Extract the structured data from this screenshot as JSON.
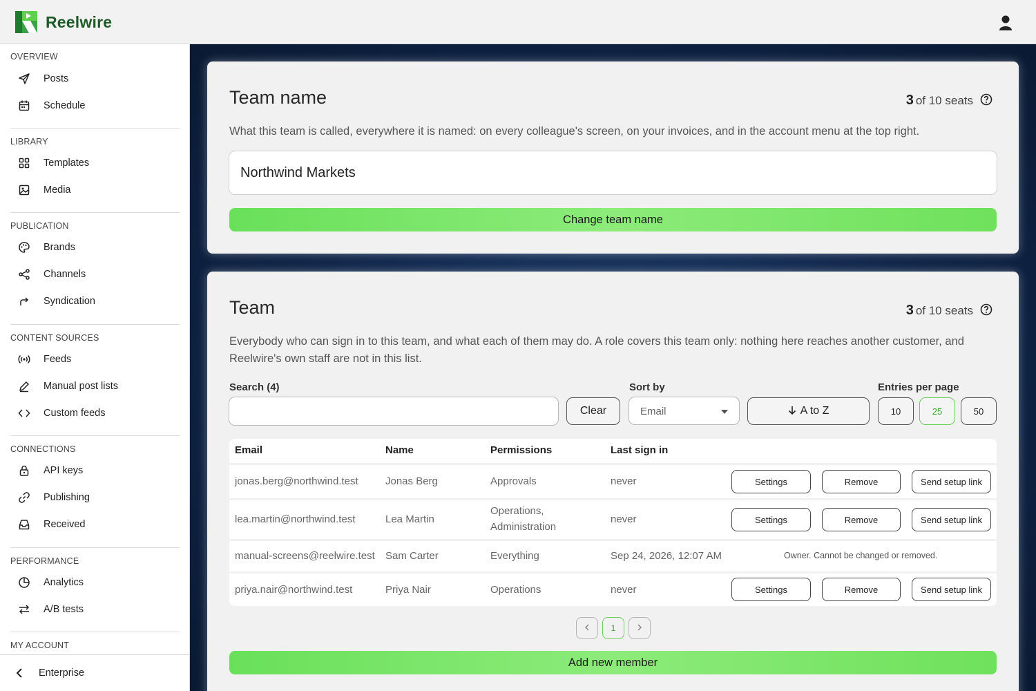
{
  "app": {
    "brand": "Reelwire"
  },
  "sidebar": {
    "sections": [
      {
        "heading": "OVERVIEW",
        "items": [
          {
            "label": "Posts",
            "icon": "send-icon"
          },
          {
            "label": "Schedule",
            "icon": "calendar-icon"
          }
        ]
      },
      {
        "heading": "LIBRARY",
        "items": [
          {
            "label": "Templates",
            "icon": "grid-icon"
          },
          {
            "label": "Media",
            "icon": "image-icon"
          }
        ]
      },
      {
        "heading": "PUBLICATION",
        "items": [
          {
            "label": "Brands",
            "icon": "palette-icon"
          },
          {
            "label": "Channels",
            "icon": "share-icon"
          },
          {
            "label": "Syndication",
            "icon": "forward-arrow-icon"
          }
        ]
      },
      {
        "heading": "CONTENT SOURCES",
        "items": [
          {
            "label": "Feeds",
            "icon": "broadcast-icon"
          },
          {
            "label": "Manual post lists",
            "icon": "pencil-icon"
          },
          {
            "label": "Custom feeds",
            "icon": "code-icon"
          }
        ]
      },
      {
        "heading": "CONNECTIONS",
        "items": [
          {
            "label": "API keys",
            "icon": "lock-icon"
          },
          {
            "label": "Publishing",
            "icon": "link-icon"
          },
          {
            "label": "Received",
            "icon": "inbox-icon"
          }
        ]
      },
      {
        "heading": "PERFORMANCE",
        "items": [
          {
            "label": "Analytics",
            "icon": "pie-chart-icon"
          },
          {
            "label": "A/B tests",
            "icon": "swap-icon"
          }
        ]
      },
      {
        "heading": "MY ACCOUNT",
        "items": []
      }
    ],
    "footer": {
      "label": "Enterprise"
    }
  },
  "team_name_card": {
    "title": "Team name",
    "seats_used": "3",
    "seats_text": "of 10 seats",
    "description": "What this team is called, everywhere it is named: on every colleague's screen, on your invoices, and in the account menu at the top right.",
    "name_value": "Northwind Markets",
    "submit_label": "Change team name"
  },
  "team_card": {
    "title": "Team",
    "seats_used": "3",
    "seats_text": "of 10 seats",
    "description": "Everybody who can sign in to this team, and what each of them may do. A role covers this team only: nothing here reaches another customer, and Reelwire's own staff are not in this list.",
    "search_label": "Search (4)",
    "search_value": "",
    "clear_label": "Clear",
    "sort_label": "Sort by",
    "sort_value": "Email",
    "order_label": "A to Z",
    "entries_label": "Entries per page",
    "entries_options": [
      "10",
      "25",
      "50"
    ],
    "entries_selected": "25",
    "columns": [
      "Email",
      "Name",
      "Permissions",
      "Last sign in"
    ],
    "rows": [
      {
        "email": "jonas.berg@northwind.test",
        "name": "Jonas Berg",
        "permissions": "Approvals",
        "last_sign_in": "never"
      },
      {
        "email": "lea.martin@northwind.test",
        "name": "Lea Martin",
        "permissions": "Operations,\nAdministration",
        "last_sign_in": "never"
      },
      {
        "email": "manual-screens@reelwire.test",
        "name": "Sam Carter",
        "permissions": "Everything",
        "last_sign_in": "Sep 24, 2026, 12:07 AM",
        "note": "Owner. Cannot be changed or removed."
      },
      {
        "email": "priya.nair@northwind.test",
        "name": "Priya Nair",
        "permissions": "Operations",
        "last_sign_in": "never"
      }
    ],
    "row_actions": {
      "settings": "Settings",
      "remove": "Remove",
      "setup": "Send setup link"
    },
    "pagination": {
      "current_page": "1"
    },
    "add_label": "Add new member"
  },
  "colors": {
    "accent_green": "#6fe15c",
    "brand_dark_green": "#1f5a2a",
    "background_navy": "#0f2447"
  }
}
